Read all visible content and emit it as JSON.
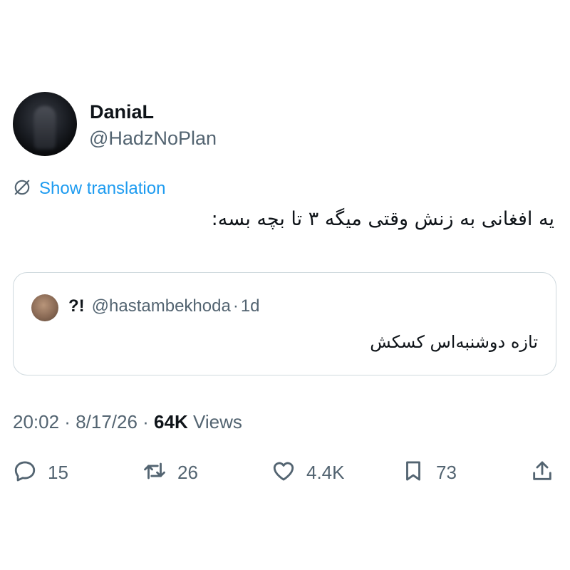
{
  "author": {
    "display_name": "DaniaL",
    "handle": "@HadzNoPlan"
  },
  "translate": {
    "label": "Show translation",
    "icon": "translate-icon"
  },
  "tweet": {
    "text": "یه افغانی به زنش وقتی میگه ۳ تا بچه بسه:"
  },
  "quote": {
    "name": "?!",
    "handle": "@hastambekhoda",
    "separator": "·",
    "time": "1d",
    "text": "تازه دوشنبه‌اس کسکش"
  },
  "meta": {
    "time": "20:02",
    "separator1": " · ",
    "date": "8/17/26",
    "separator2": " · ",
    "views_count": "64K",
    "views_label": "Views"
  },
  "actions": {
    "reply": {
      "icon": "reply-icon",
      "count": "15"
    },
    "retweet": {
      "icon": "retweet-icon",
      "count": "26"
    },
    "like": {
      "icon": "heart-icon",
      "count": "4.4K"
    },
    "bookmark": {
      "icon": "bookmark-icon",
      "count": "73"
    },
    "share": {
      "icon": "share-icon"
    }
  },
  "colors": {
    "text": "#0f1419",
    "secondary": "#536471",
    "link": "#1d9bf0",
    "border": "#cfd9de"
  }
}
